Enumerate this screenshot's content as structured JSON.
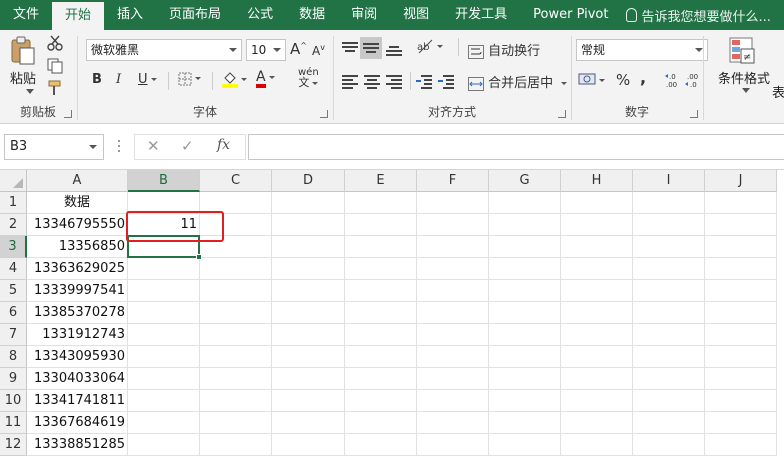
{
  "ribbon_tabs": [
    "文件",
    "开始",
    "插入",
    "页面布局",
    "公式",
    "数据",
    "审阅",
    "视图",
    "开发工具",
    "Power Pivot"
  ],
  "tell_me": "告诉我您想要做什么...",
  "clipboard": {
    "paste_label": "粘贴",
    "group_label": "剪贴板"
  },
  "font": {
    "name": "微软雅黑",
    "size": "10",
    "group_label": "字体",
    "grow_label": "A",
    "shrink_label": "A",
    "bold": "B",
    "italic": "I",
    "underline": "U",
    "font_color_label": "A",
    "phonetic_label": "wén"
  },
  "alignment": {
    "wrap_text": "自动换行",
    "merge_center": "合并后居中",
    "group_label": "对齐方式"
  },
  "number": {
    "format": "常规",
    "percent": "%",
    "comma": ",",
    "group_label": "数字"
  },
  "styles": {
    "conditional_formatting": "条件格式",
    "table_partial": "表"
  },
  "formula_bar": {
    "name_box": "B3",
    "fx_label": "fx",
    "content": ""
  },
  "sheet": {
    "columns": [
      "A",
      "B",
      "C",
      "D",
      "E",
      "F",
      "G",
      "H",
      "I",
      "J"
    ],
    "rows": [
      "1",
      "2",
      "3",
      "4",
      "5",
      "6",
      "7",
      "8",
      "9",
      "10",
      "11",
      "12"
    ],
    "selected_cell": "B3",
    "header_a1": "数据",
    "column_a": [
      "13346795550",
      "13356850",
      "13363629025",
      "13339997541",
      "13385370278",
      "1331912743",
      "13343095930",
      "13304033064",
      "13341741811",
      "13367684619",
      "13338851285"
    ],
    "b2": "11"
  },
  "colors": {
    "excel_green": "#217346",
    "highlight_red": "#e02020"
  }
}
